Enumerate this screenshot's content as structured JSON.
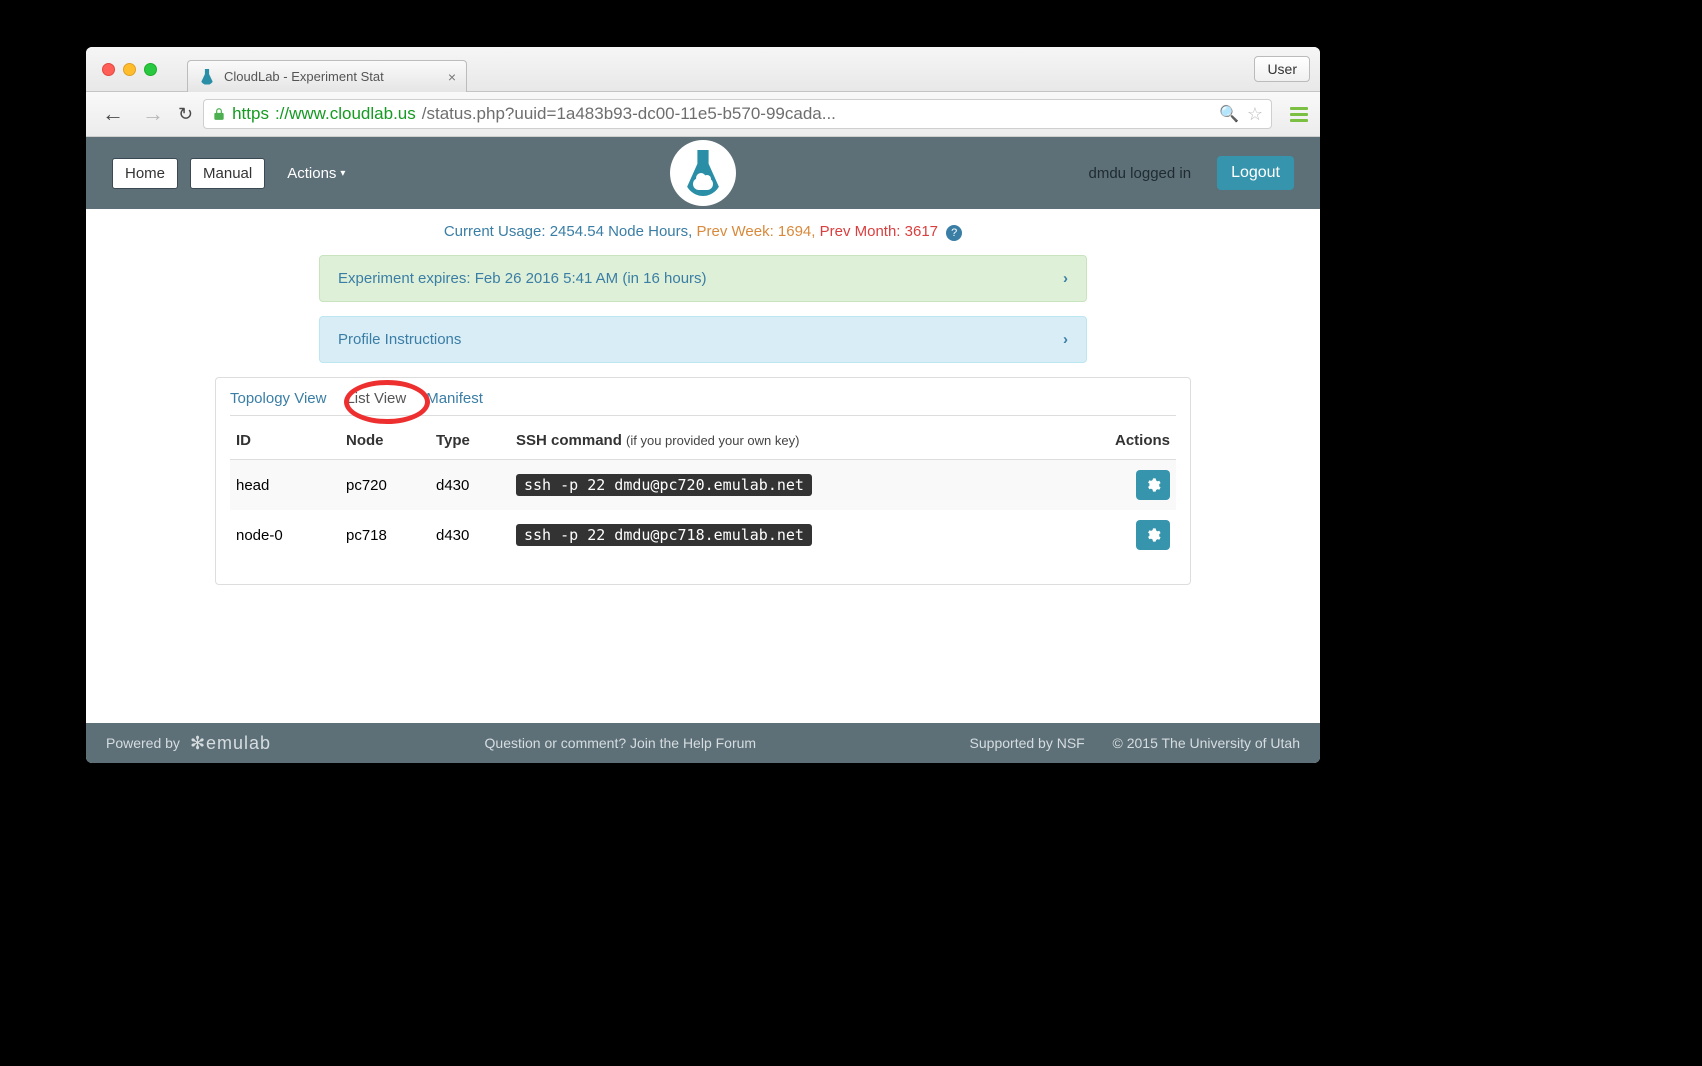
{
  "browser": {
    "tab_title": "CloudLab - Experiment Stat",
    "user_button": "User",
    "url_protocol": "https",
    "url_host": "://www.cloudlab.us",
    "url_path": "/status.php?uuid=1a483b93-dc00-11e5-b570-99cada..."
  },
  "navbar": {
    "home": "Home",
    "manual": "Manual",
    "actions": "Actions",
    "logged_in": "dmdu logged in",
    "logout": "Logout"
  },
  "usage": {
    "current_label": "Current Usage:",
    "current_value": "2454.54 Node Hours,",
    "prev_week": "Prev Week: 1694,",
    "prev_month": "Prev Month: 3617",
    "help": "?"
  },
  "expiry_panel": "Experiment expires: Feb 26 2016 5:41 AM (in 16 hours)",
  "instructions_panel": "Profile Instructions",
  "tabs": {
    "topology": "Topology View",
    "list": "List View",
    "manifest": "Manifest"
  },
  "columns": {
    "id": "ID",
    "node": "Node",
    "type": "Type",
    "ssh": "SSH command",
    "ssh_note": "(if you provided your own key)",
    "actions": "Actions"
  },
  "rows": [
    {
      "id": "head",
      "node": "pc720",
      "type": "d430",
      "ssh": "ssh -p 22 dmdu@pc720.emulab.net"
    },
    {
      "id": "node-0",
      "node": "pc718",
      "type": "d430",
      "ssh": "ssh -p 22 dmdu@pc718.emulab.net"
    }
  ],
  "footer": {
    "powered": "Powered by",
    "emulab": "✻emulab",
    "center": "Question or comment? Join the Help Forum",
    "supported": "Supported by NSF",
    "copyright": "© 2015 The University of Utah"
  }
}
